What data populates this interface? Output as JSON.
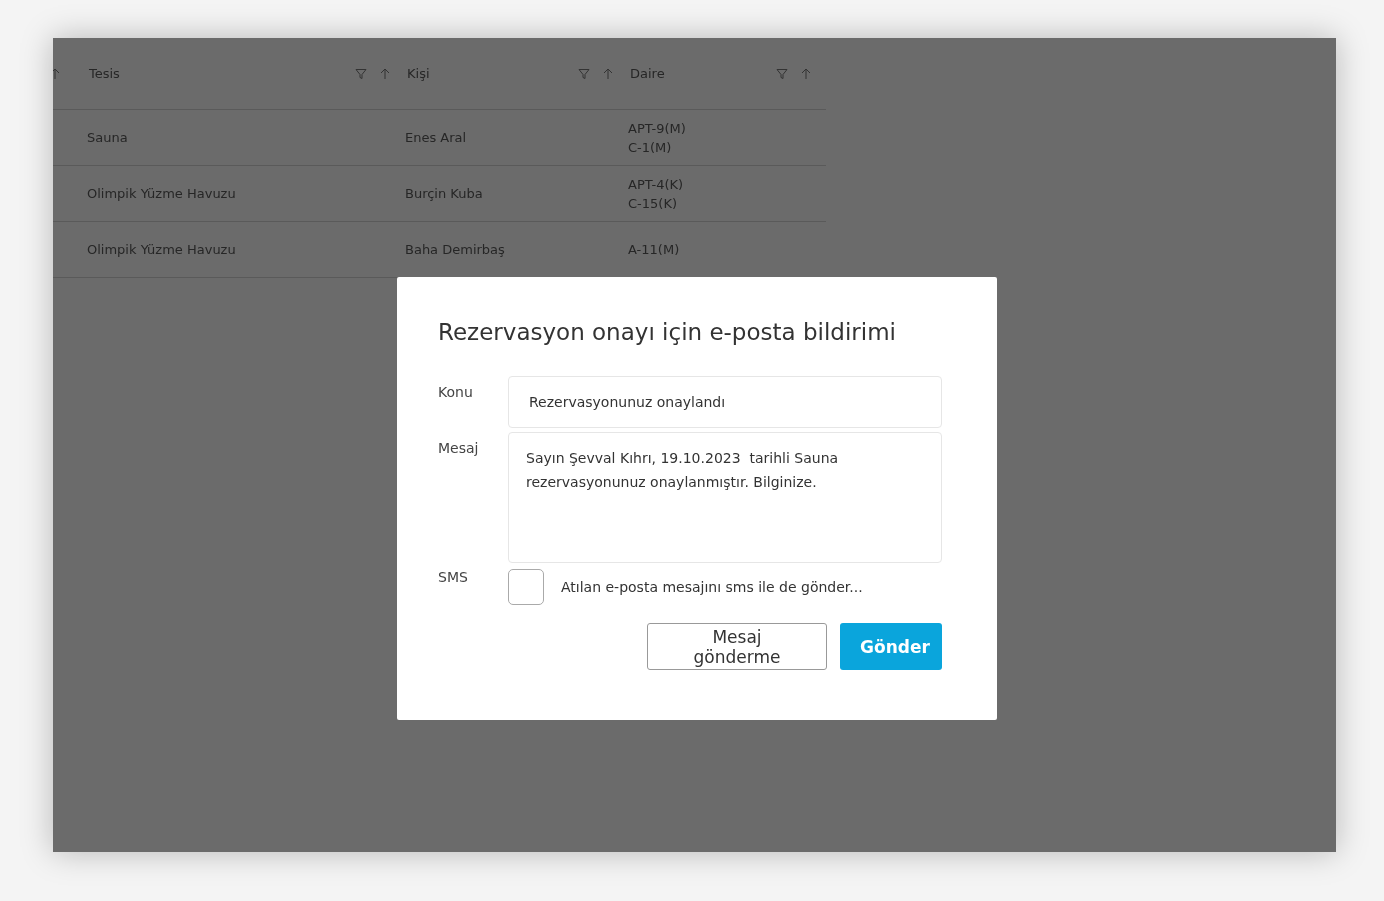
{
  "table": {
    "columns": [
      {
        "label": "Tesis"
      },
      {
        "label": "Kişi"
      },
      {
        "label": "Daire"
      }
    ],
    "rows": [
      {
        "cells": [
          "Sauna",
          "Enes Aral",
          [
            "APT-9(M)",
            "C-1(M)"
          ]
        ]
      },
      {
        "cells": [
          "Olimpik Yüzme Havuzu",
          "Burçin Kuba",
          [
            "APT-4(K)",
            "C-15(K)"
          ]
        ]
      },
      {
        "cells": [
          "Olimpik Yüzme Havuzu",
          "Baha Demirbaş",
          [
            "A-11(M)"
          ]
        ]
      }
    ]
  },
  "dialog": {
    "title": "Rezervasyon onayı için e-posta bildirimi",
    "subject": {
      "label": "Konu",
      "value": "Rezervasyonunuz onaylandı"
    },
    "message": {
      "label": "Mesaj",
      "value": "Sayın Şevval Kıhrı, 19.10.2023  tarihli Sauna\nrezervasyonunuz onaylanmıştır. Bilginize."
    },
    "sms": {
      "label": "SMS",
      "checked": false,
      "text": "Atılan e-posta mesajını sms ile de gönder..."
    },
    "buttons": [
      {
        "label": "Mesaj gönderme",
        "kind": "secondary"
      },
      {
        "label": "Gönder",
        "kind": "primary"
      }
    ]
  }
}
